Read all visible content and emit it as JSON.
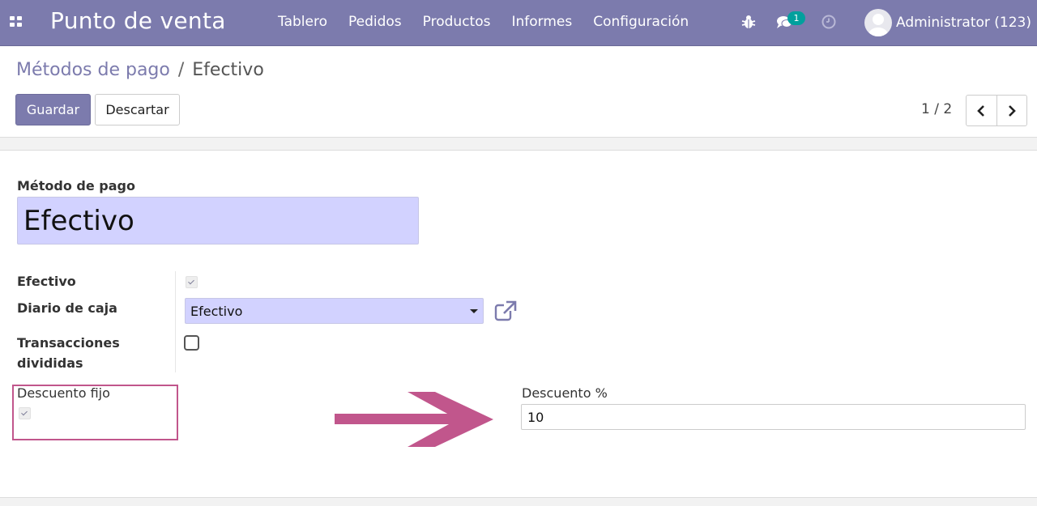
{
  "navbar": {
    "app_title": "Punto de venta",
    "menu": [
      "Tablero",
      "Pedidos",
      "Productos",
      "Informes",
      "Configuración"
    ],
    "chat_badge": "1",
    "user_name": "Administrator (123)",
    "bg_color": "#7c7bad"
  },
  "control_panel": {
    "breadcrumb_parent": "Métodos de pago",
    "breadcrumb_separator": "/",
    "breadcrumb_current": "Efectivo",
    "save_label": "Guardar",
    "discard_label": "Descartar",
    "pager": "1 / 2"
  },
  "form": {
    "method_label": "Método de pago",
    "method_value": "Efectivo",
    "efectivo_label": "Efectivo",
    "efectivo_checked": true,
    "diario_label": "Diario de caja",
    "diario_value": "Efectivo",
    "trans_label": "Transacciones divididas",
    "trans_checked": false,
    "descuento_fijo_label": "Descuento fijo",
    "descuento_fijo_checked": true,
    "descuento_pct_label": "Descuento %",
    "descuento_pct_value": "10"
  },
  "annotation": {
    "highlight_color": "#c1568c"
  }
}
